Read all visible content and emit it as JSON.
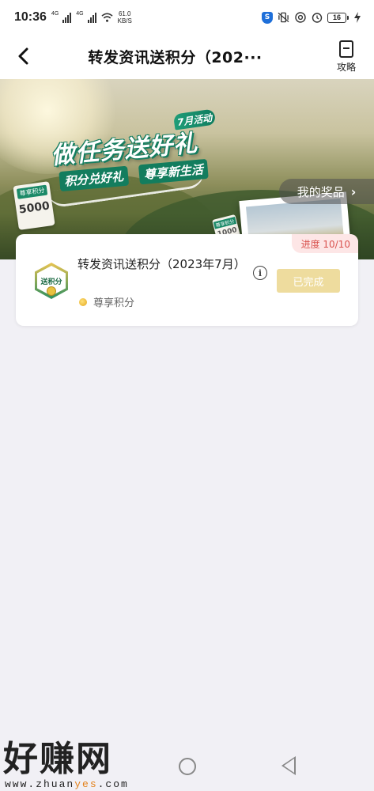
{
  "status_bar": {
    "time": "10:36",
    "net1": "4G",
    "net2": "4G",
    "speed_value": "61.0",
    "speed_unit": "KB/S",
    "battery": "16"
  },
  "nav": {
    "title": "转发资讯送积分（202···",
    "guide_label": "攻略"
  },
  "banner": {
    "activity_tag": "7月活动",
    "title": "做任务送好礼",
    "sub_left": "积分兑好礼",
    "sub_right": "尊享新生活",
    "ticket_left_label": "尊享积分",
    "ticket_left_value": "5000",
    "ticket_right_label": "尊享积分",
    "ticket_right_value": "1000",
    "prize_button": "我的奖品"
  },
  "task": {
    "progress": "进度 10/10",
    "icon_label": "送积分",
    "title": "转发资讯送积分（2023年7月）",
    "points_label": "尊享积分",
    "status_button": "已完成"
  },
  "watermark": {
    "main": "好赚网",
    "url_prefix": "www.zhuan",
    "url_highlight": "yes",
    "url_suffix": ".com"
  },
  "colors": {
    "accent_green": "#137d5e",
    "progress_red": "#d9534f",
    "done_gold": "#eedc9e"
  }
}
